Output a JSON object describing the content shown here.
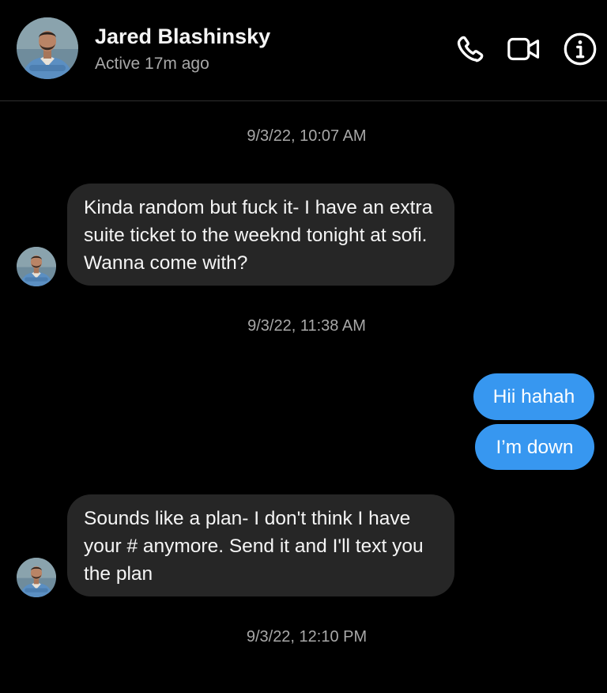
{
  "header": {
    "contact_name": "Jared Blashinsky",
    "status": "Active 17m ago",
    "icons": [
      "phone-icon",
      "video-camera-icon",
      "info-icon"
    ]
  },
  "thread": {
    "timestamps": [
      "9/3/22, 10:07 AM",
      "9/3/22, 11:38 AM",
      "9/3/22, 12:10 PM"
    ],
    "messages": [
      {
        "direction": "incoming",
        "text": "Kinda random but fuck it- I have an extra suite ticket to the weeknd tonight at sofi. Wanna come with?"
      },
      {
        "direction": "outgoing",
        "text": "Hii hahah"
      },
      {
        "direction": "outgoing",
        "text": "I’m down"
      },
      {
        "direction": "incoming",
        "text": "Sounds like a plan- I don't think I have your # anymore. Send it and I'll text you the plan"
      }
    ]
  },
  "colors": {
    "background": "#000000",
    "incoming_bubble": "#262626",
    "outgoing_bubble": "#3797f0",
    "secondary_text": "#a8a8a8"
  }
}
